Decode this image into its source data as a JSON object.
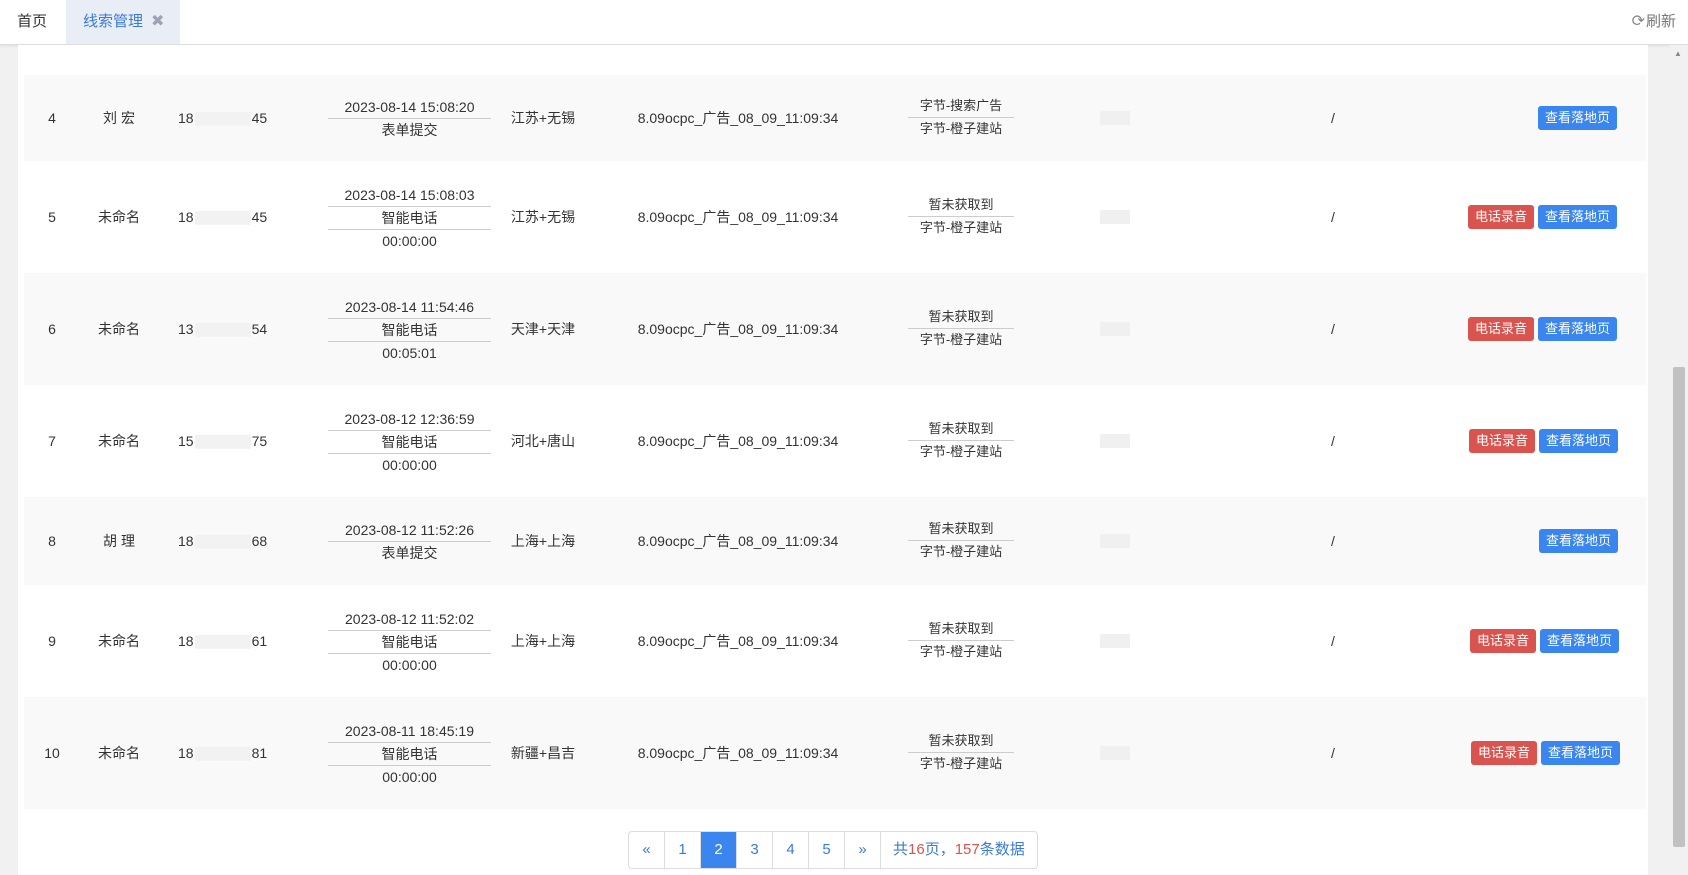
{
  "tabs": {
    "home": "首页",
    "active": "线索管理"
  },
  "refresh_label": "刷新",
  "rows": [
    {
      "no": "4",
      "name": "刘  宏",
      "phone_pre": "18",
      "phone_suf": "45",
      "time": "2023-08-14 15:08:20",
      "type": "表单提交",
      "duration": "",
      "region": "江苏+无锡",
      "plan": "8.09ocpc_广告_08_09_11:09:34",
      "src1": "字节-搜索广告",
      "src2": "字节-橙子建站",
      "slash": "/",
      "show_rec": false
    },
    {
      "no": "5",
      "name": "未命名",
      "phone_pre": "18",
      "phone_suf": "45",
      "time": "2023-08-14 15:08:03",
      "type": "智能电话",
      "duration": "00:00:00",
      "region": "江苏+无锡",
      "plan": "8.09ocpc_广告_08_09_11:09:34",
      "src1": "暂未获取到",
      "src2": "字节-橙子建站",
      "slash": "/",
      "show_rec": true
    },
    {
      "no": "6",
      "name": "未命名",
      "phone_pre": "13",
      "phone_suf": "54",
      "time": "2023-08-14 11:54:46",
      "type": "智能电话",
      "duration": "00:05:01",
      "region": "天津+天津",
      "plan": "8.09ocpc_广告_08_09_11:09:34",
      "src1": "暂未获取到",
      "src2": "字节-橙子建站",
      "slash": "/",
      "show_rec": true
    },
    {
      "no": "7",
      "name": "未命名",
      "phone_pre": "15",
      "phone_suf": "75",
      "time": "2023-08-12 12:36:59",
      "type": "智能电话",
      "duration": "00:00:00",
      "region": "河北+唐山",
      "plan": "8.09ocpc_广告_08_09_11:09:34",
      "src1": "暂未获取到",
      "src2": "字节-橙子建站",
      "slash": "/",
      "show_rec": true
    },
    {
      "no": "8",
      "name": "胡  理",
      "phone_pre": "18",
      "phone_suf": "68",
      "time": "2023-08-12 11:52:26",
      "type": "表单提交",
      "duration": "",
      "region": "上海+上海",
      "plan": "8.09ocpc_广告_08_09_11:09:34",
      "src1": "暂未获取到",
      "src2": "字节-橙子建站",
      "slash": "/",
      "show_rec": false
    },
    {
      "no": "9",
      "name": "未命名",
      "phone_pre": "18",
      "phone_suf": "61",
      "time": "2023-08-12 11:52:02",
      "type": "智能电话",
      "duration": "00:00:00",
      "region": "上海+上海",
      "plan": "8.09ocpc_广告_08_09_11:09:34",
      "src1": "暂未获取到",
      "src2": "字节-橙子建站",
      "slash": "/",
      "show_rec": true
    },
    {
      "no": "10",
      "name": "未命名",
      "phone_pre": "18",
      "phone_suf": "81",
      "time": "2023-08-11 18:45:19",
      "type": "智能电话",
      "duration": "00:00:00",
      "region": "新疆+昌吉",
      "plan": "8.09ocpc_广告_08_09_11:09:34",
      "src1": "暂未获取到",
      "src2": "字节-橙子建站",
      "slash": "/",
      "show_rec": true
    }
  ],
  "buttons": {
    "recording": "电话录音",
    "landing": "查看落地页"
  },
  "pagination": {
    "prev": "«",
    "next": "»",
    "pages": [
      "1",
      "2",
      "3",
      "4",
      "5"
    ],
    "current": "2",
    "summary_prefix": "共",
    "total_pages": "16",
    "summary_mid": "页，",
    "total_records": "157",
    "summary_suffix": "条数据"
  }
}
